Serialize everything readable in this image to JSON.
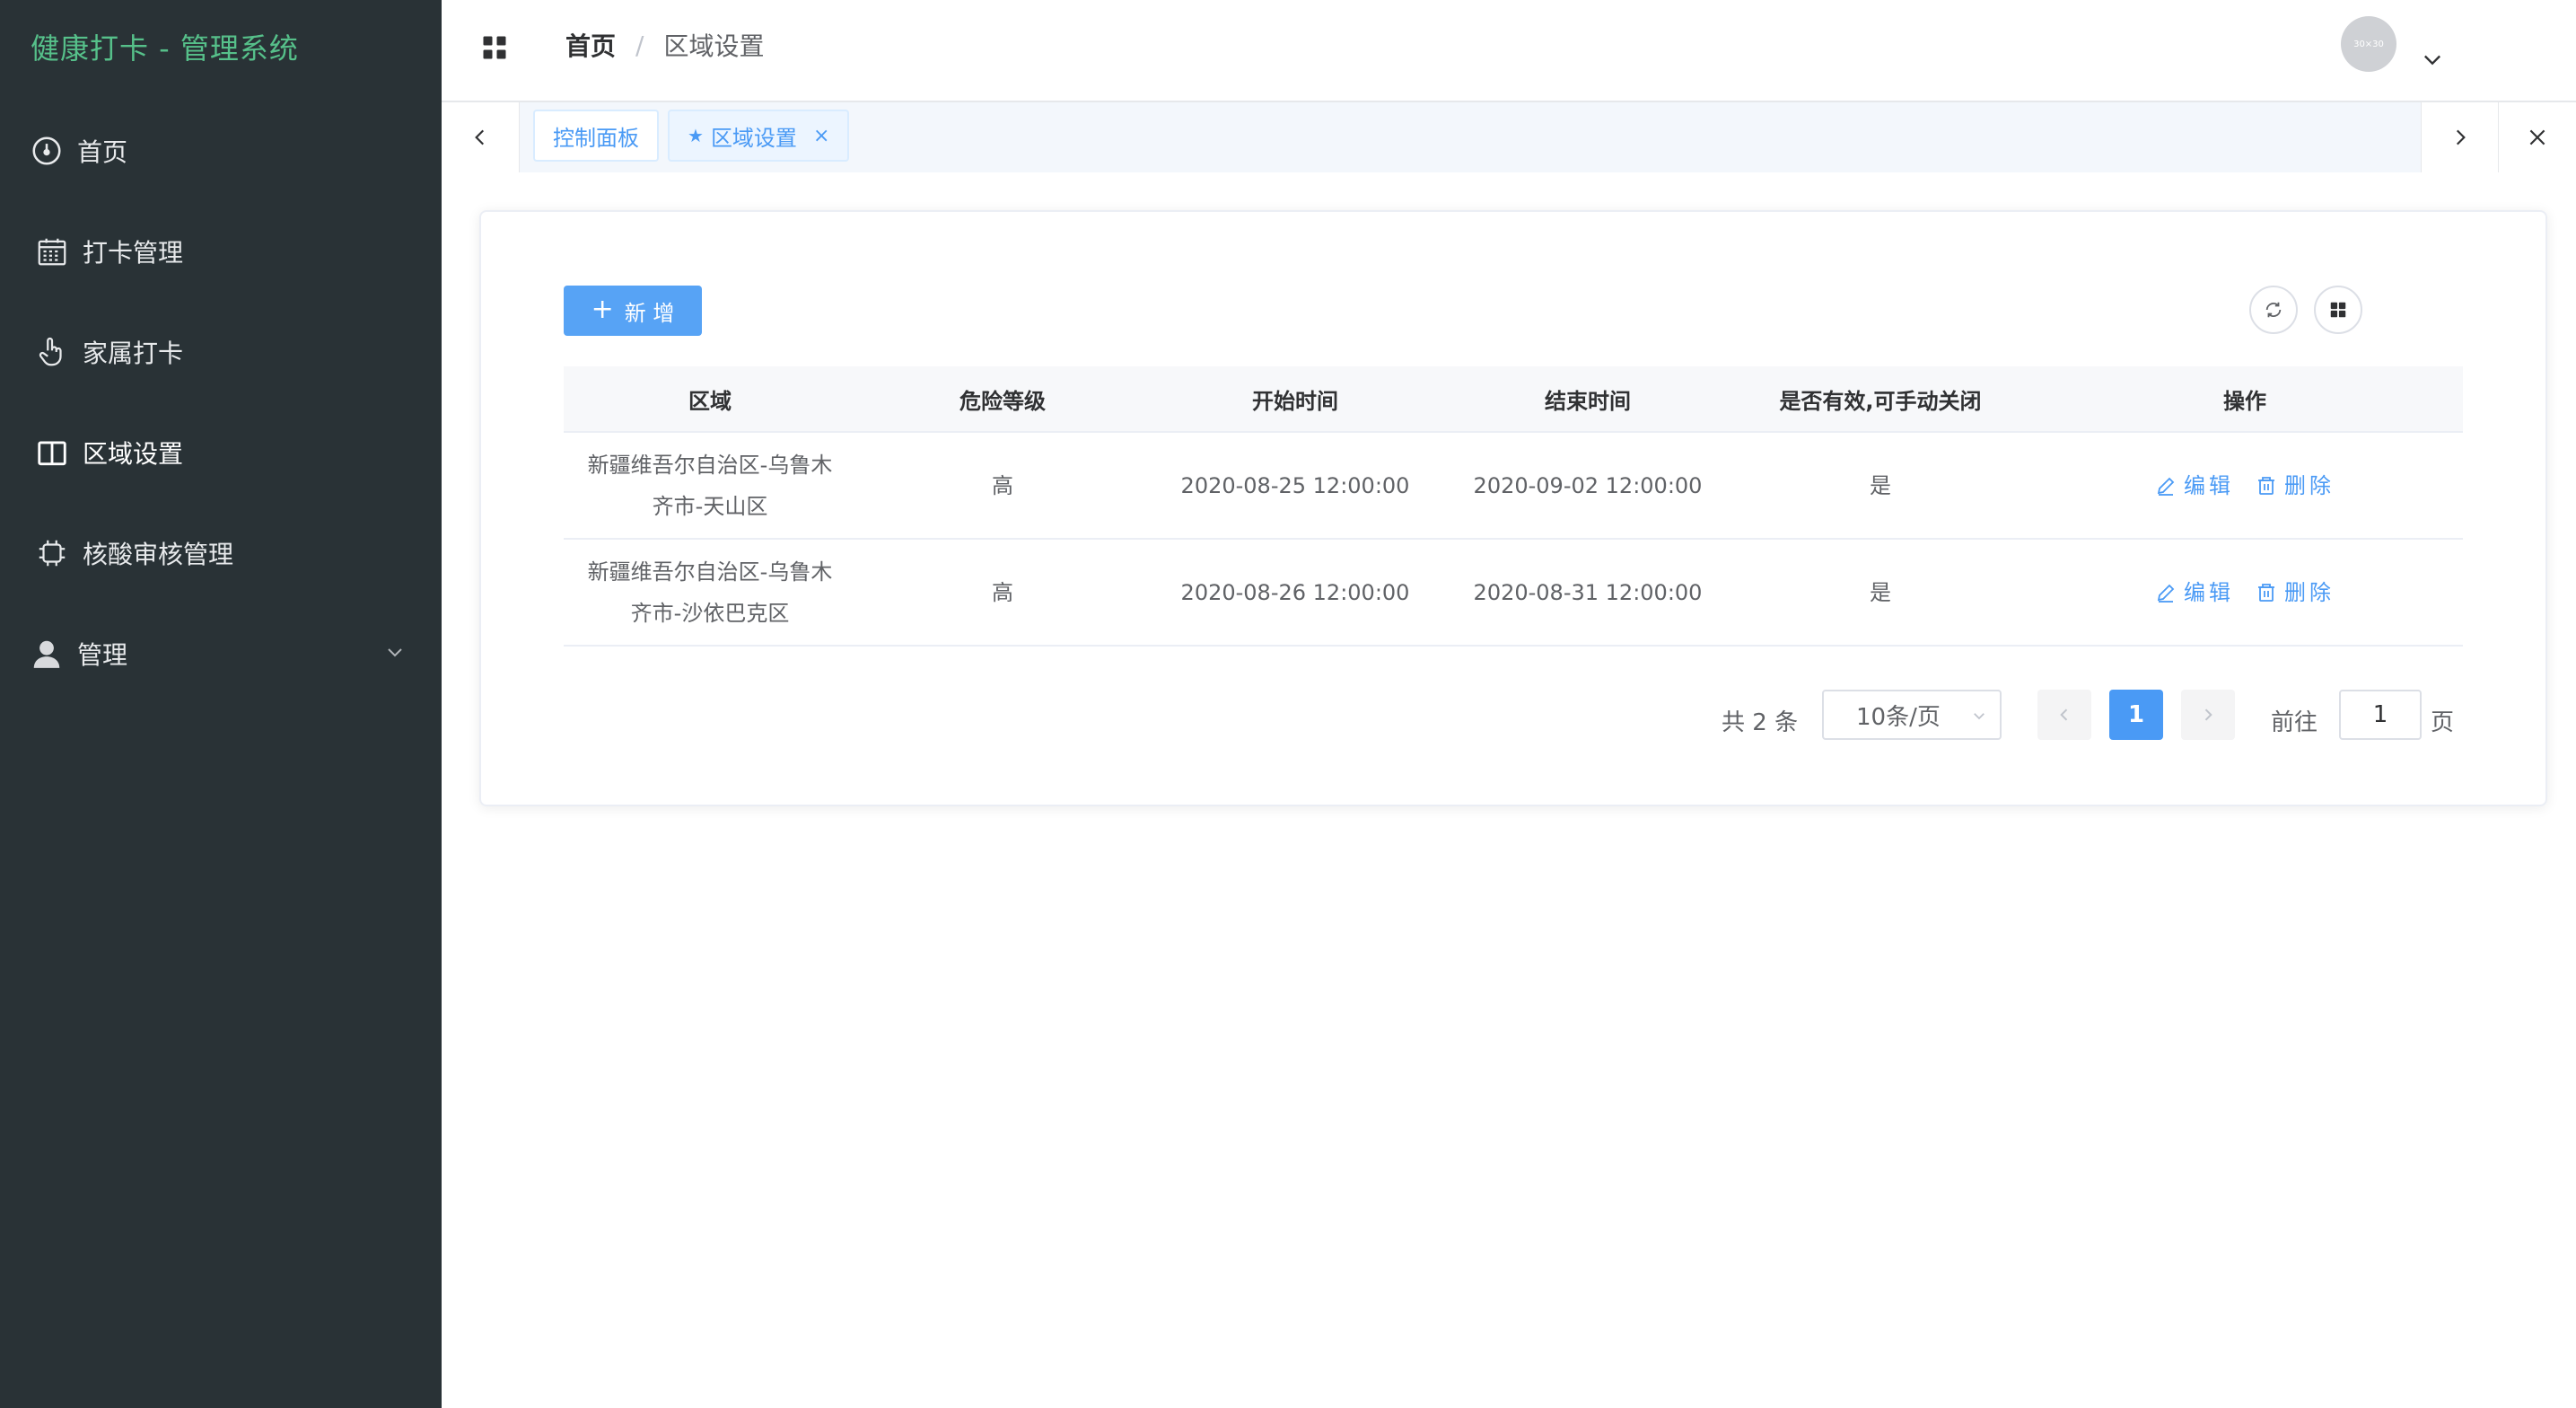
{
  "app": {
    "title": "健康打卡 - 管理系统"
  },
  "sidebar": {
    "items": [
      {
        "label": "首页",
        "icon": "dashboard-icon"
      },
      {
        "label": "打卡管理",
        "icon": "calendar-icon"
      },
      {
        "label": "家属打卡",
        "icon": "hand-pointer-icon"
      },
      {
        "label": "区域设置",
        "icon": "book-icon"
      },
      {
        "label": "核酸审核管理",
        "icon": "chip-icon"
      },
      {
        "label": "管理",
        "icon": "user-icon"
      }
    ]
  },
  "header": {
    "breadcrumb_home": "首页",
    "breadcrumb_sep": "/",
    "breadcrumb_current": "区域设置",
    "avatar_text": "30×30"
  },
  "tags": {
    "tag1": "控制面板",
    "tag2": "区域设置",
    "tag2_star": "★",
    "tag2_close": "×"
  },
  "toolbar": {
    "add_label": "新 增",
    "add_icon": "+"
  },
  "table": {
    "headers": [
      "区域",
      "危险等级",
      "开始时间",
      "结束时间",
      "是否有效,可手动关闭",
      "操作"
    ],
    "rows": [
      {
        "area_line1": "新疆维吾尔自治区-乌鲁木",
        "area_line2": "齐市-天山区",
        "level": "高",
        "start": "2020-08-25 12:00:00",
        "end": "2020-09-02 12:00:00",
        "valid": "是"
      },
      {
        "area_line1": "新疆维吾尔自治区-乌鲁木",
        "area_line2": "齐市-沙依巴克区",
        "level": "高",
        "start": "2020-08-26 12:00:00",
        "end": "2020-08-31 12:00:00",
        "valid": "是"
      }
    ],
    "edit_label": "编辑",
    "delete_label": "删除"
  },
  "pagination": {
    "total": "共 2 条",
    "page_size": "10条/页",
    "current_page": "1",
    "goto_label": "前往",
    "goto_value": "1",
    "goto_unit": "页"
  },
  "colors": {
    "accent": "#4a9af5",
    "sidebar_bg": "#293236",
    "brand": "#56c08a"
  }
}
